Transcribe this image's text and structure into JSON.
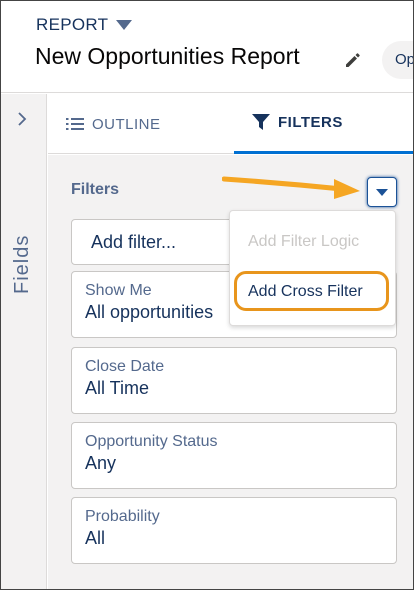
{
  "header": {
    "report_type": "REPORT",
    "report_title": "New Opportunities Report",
    "pill_label": "Op"
  },
  "rail": {
    "label": "Fields"
  },
  "tabs": [
    {
      "label": "OUTLINE",
      "icon": "list-icon"
    },
    {
      "label": "FILTERS",
      "icon": "funnel-icon",
      "active": true
    }
  ],
  "filters": {
    "heading": "Filters",
    "add_filter_placeholder": "Add filter...",
    "items": [
      {
        "label": "Show Me",
        "value": "All opportunities"
      },
      {
        "label": "Close Date",
        "value": "All Time"
      },
      {
        "label": "Opportunity Status",
        "value": "Any"
      },
      {
        "label": "Probability",
        "value": "All"
      }
    ]
  },
  "menu": {
    "items": [
      {
        "label": "Add Filter Logic",
        "disabled": true
      },
      {
        "label": "Add Cross Filter",
        "highlighted": true
      }
    ]
  },
  "colors": {
    "brand_blue": "#0070d2",
    "text_dark": "#16325c",
    "highlight_orange": "#e8951c",
    "arrow_orange": "#f5a623"
  }
}
